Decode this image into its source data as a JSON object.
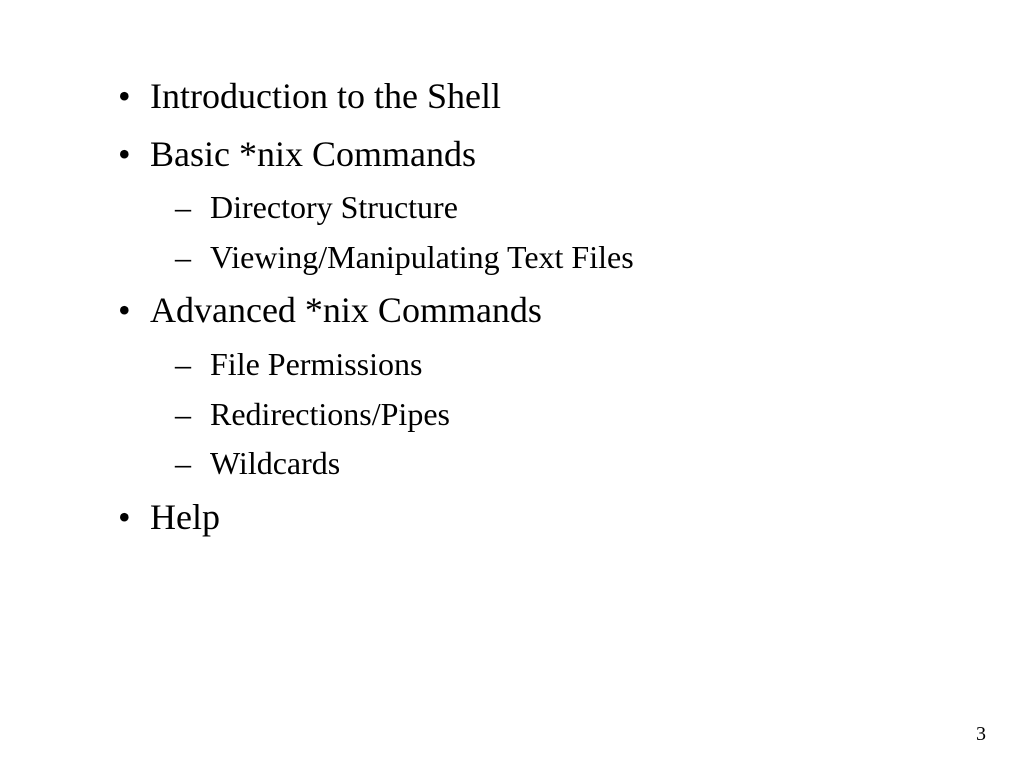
{
  "slide": {
    "items": [
      {
        "level": 1,
        "text": "Introduction to the Shell"
      },
      {
        "level": 1,
        "text": "Basic *nix Commands"
      },
      {
        "level": 2,
        "text": "Directory Structure"
      },
      {
        "level": 2,
        "text": "Viewing/Manipulating Text Files"
      },
      {
        "level": 1,
        "text": "Advanced *nix Commands"
      },
      {
        "level": 2,
        "text": "File Permissions"
      },
      {
        "level": 2,
        "text": "Redirections/Pipes"
      },
      {
        "level": 2,
        "text": "Wildcards"
      },
      {
        "level": 1,
        "text": "Help"
      }
    ],
    "page_number": "3"
  }
}
